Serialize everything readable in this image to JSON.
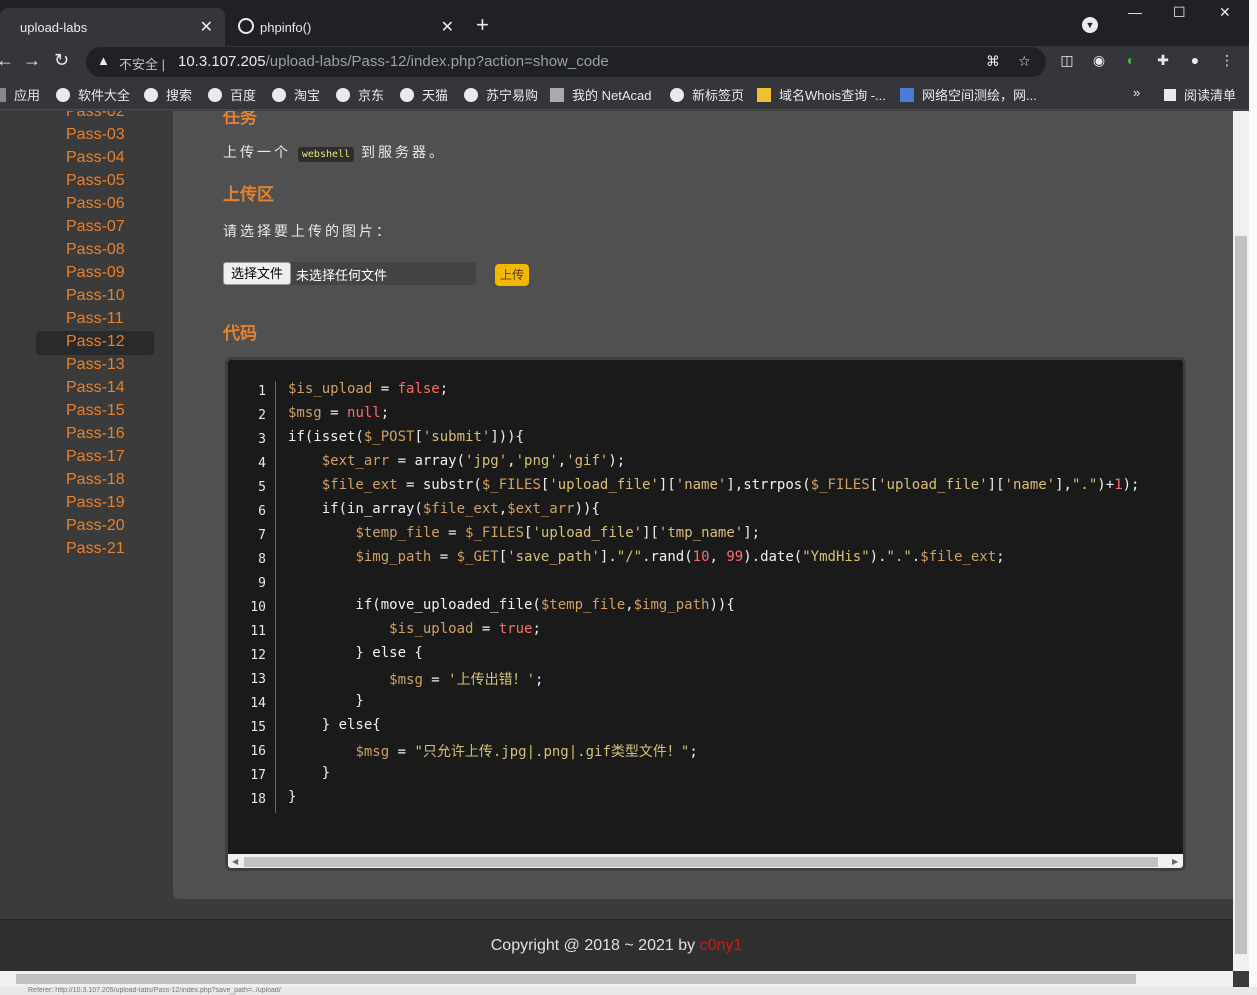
{
  "browser": {
    "tabs": [
      {
        "title": "upload-labs",
        "close": "✕"
      },
      {
        "title": "phpinfo()",
        "close": "✕"
      }
    ],
    "new_tab": "+",
    "window_controls": {
      "minimize": "—",
      "maximize": "☐",
      "close": "✕"
    },
    "address": {
      "security_label": "不安全",
      "separator": "|",
      "host": "10.3.107.205",
      "path": "/upload-labs/Pass-12/index.php?action=show_code"
    },
    "bookmarks": [
      "应用",
      "软件大全",
      "搜索",
      "百度",
      "淘宝",
      "京东",
      "天猫",
      "苏宁易购",
      "我的 NetAcad",
      "新标签页",
      "域名Whois查询 -...",
      "网络空间测绘，网...",
      "阅读清单"
    ],
    "bookmarks_more": "»"
  },
  "sidebar": {
    "items": [
      "Pass-02",
      "Pass-03",
      "Pass-04",
      "Pass-05",
      "Pass-06",
      "Pass-07",
      "Pass-08",
      "Pass-09",
      "Pass-10",
      "Pass-11",
      "Pass-12",
      "Pass-13",
      "Pass-14",
      "Pass-15",
      "Pass-16",
      "Pass-17",
      "Pass-18",
      "Pass-19",
      "Pass-20",
      "Pass-21"
    ],
    "active": "Pass-12"
  },
  "main": {
    "task_heading": "任务",
    "task_text_before": "上传一个",
    "task_code": "webshell",
    "task_text_after": "到服务器。",
    "upload_heading": "上传区",
    "upload_prompt": "请选择要上传的图片：",
    "choose_file": "选择文件",
    "no_file": "未选择任何文件",
    "upload_button": "上传",
    "code_heading": "代码"
  },
  "code": {
    "line_numbers": [
      "1",
      "2",
      "3",
      "4",
      "5",
      "6",
      "7",
      "8",
      "9",
      "10",
      "11",
      "12",
      "13",
      "14",
      "15",
      "16",
      "17",
      "18"
    ],
    "lines": [
      "$is_upload = false;",
      "$msg = null;",
      "if(isset($_POST['submit'])){",
      "    $ext_arr = array('jpg','png','gif');",
      "    $file_ext = substr($_FILES['upload_file']['name'],strrpos($_FILES['upload_file']['name'],\".\")+1);",
      "    if(in_array($file_ext,$ext_arr)){",
      "        $temp_file = $_FILES['upload_file']['tmp_name'];",
      "        $img_path = $_GET['save_path'].\"/\".rand(10, 99).date(\"YmdHis\").\".\".$file_ext;",
      "",
      "        if(move_uploaded_file($temp_file,$img_path)){",
      "            $is_upload = true;",
      "        } else {",
      "            $msg = '上传出错！';",
      "        }",
      "    } else{",
      "        $msg = \"只允许上传.jpg|.png|.gif类型文件！\";",
      "    }",
      "}"
    ]
  },
  "footer": {
    "copyright": "Copyright @ 2018 ~ 2021 by ",
    "author": "c0ny1"
  },
  "statusbar": "Referer: http://10.3.107.205/upload-labs/Pass-12/index.php?save_path=../upload/",
  "colors": {
    "accent": "#e6822e",
    "upload_btn": "#f5b800",
    "author": "#d01818"
  }
}
